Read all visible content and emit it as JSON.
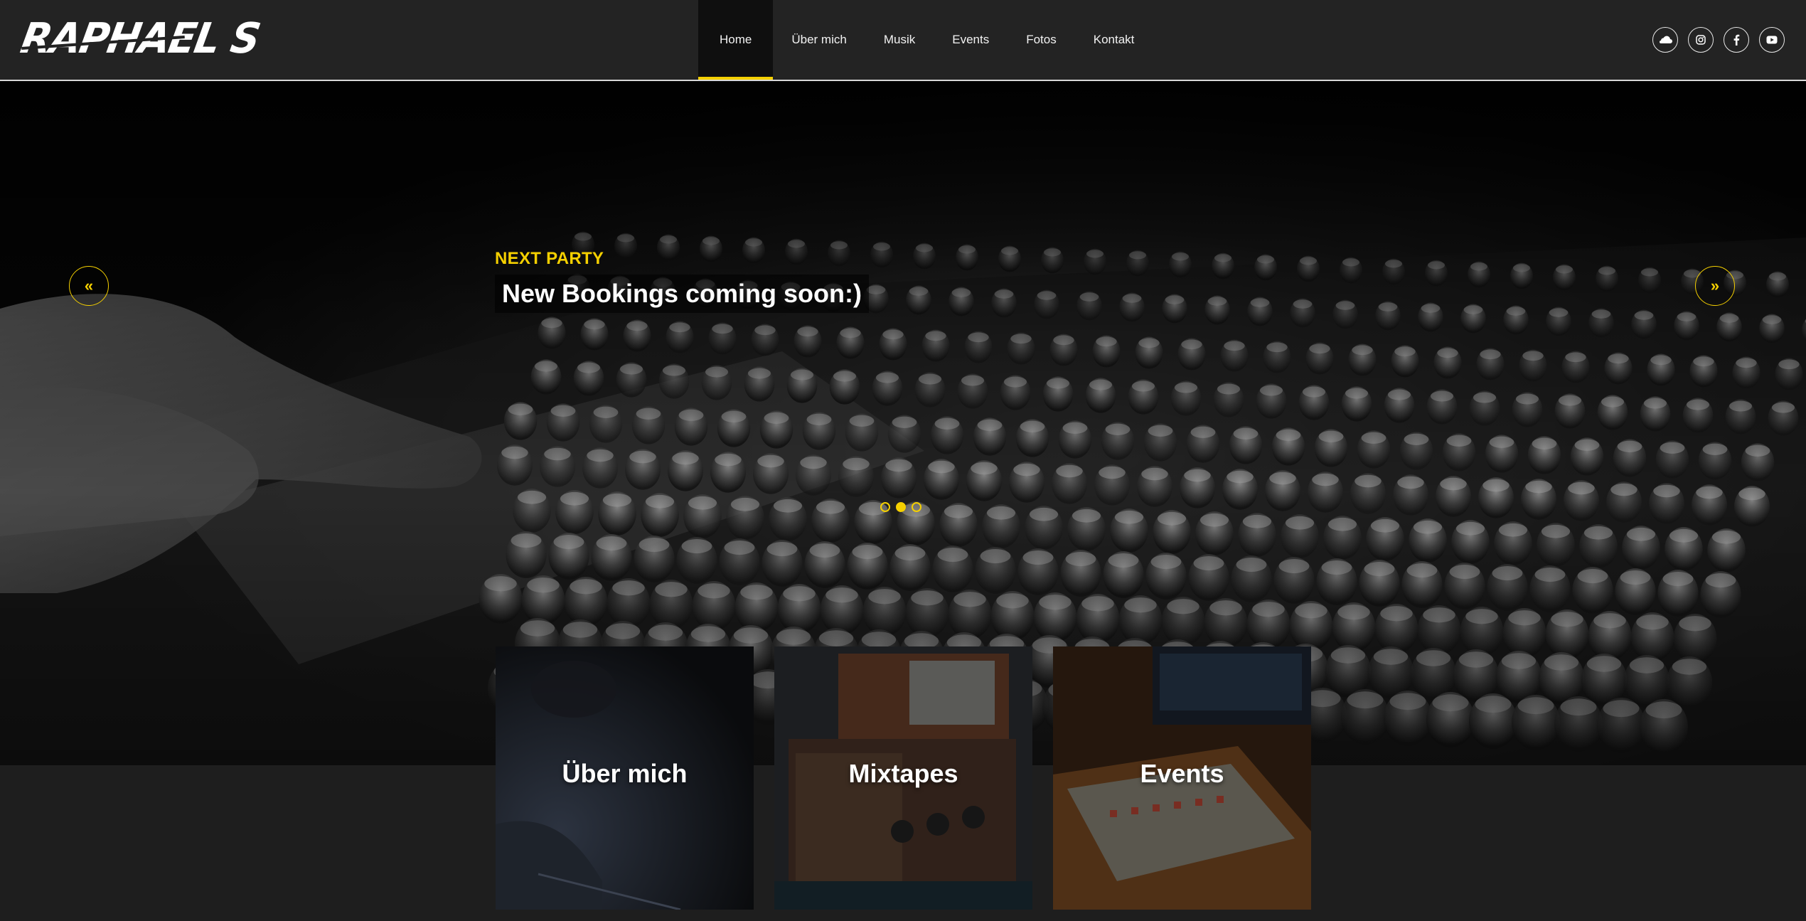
{
  "header": {
    "logo_text": "RAPHAEL S",
    "nav": [
      {
        "label": "Home",
        "active": true
      },
      {
        "label": "Über mich",
        "active": false
      },
      {
        "label": "Musik",
        "active": false
      },
      {
        "label": "Events",
        "active": false
      },
      {
        "label": "Fotos",
        "active": false
      },
      {
        "label": "Kontakt",
        "active": false
      }
    ],
    "social_icons": [
      "soundcloud-icon",
      "instagram-icon",
      "facebook-icon",
      "youtube-icon"
    ]
  },
  "hero": {
    "kicker": "NEXT PARTY",
    "title": "New Bookings coming soon:)",
    "prev_icon": "chevrons-left-icon",
    "next_icon": "chevrons-right-icon",
    "slides_count": 3,
    "active_slide": 2
  },
  "tiles": [
    {
      "label": "Über mich"
    },
    {
      "label": "Mixtapes"
    },
    {
      "label": "Events"
    }
  ],
  "colors": {
    "accent": "#f5d000",
    "header_bg": "#232323",
    "page_bg": "#1e1e1e"
  }
}
